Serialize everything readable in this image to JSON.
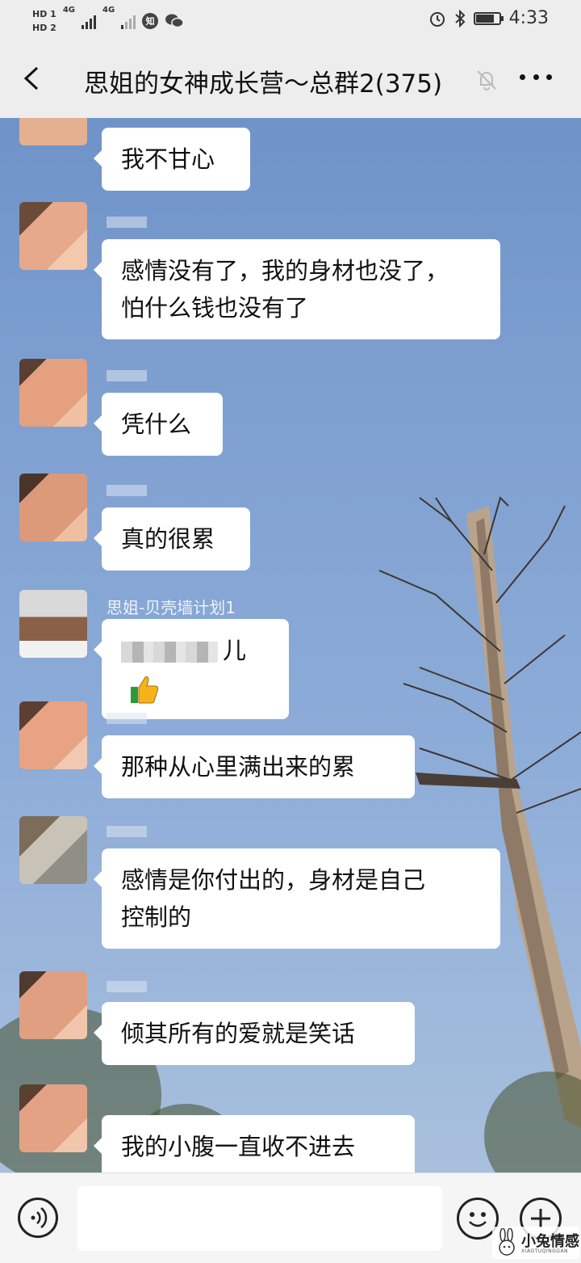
{
  "status_bar": {
    "hd1": "HD 1",
    "hd2": "HD 2",
    "net1": "4G",
    "net2": "4G",
    "app_badge": "知",
    "time": "4:33",
    "battery_level": 0.8,
    "icons": [
      "alarm-icon",
      "bluetooth-icon",
      "battery-icon",
      "wechat-icon"
    ]
  },
  "header": {
    "back_icon": "chevron-left-icon",
    "title": "思姐的女神成长营～总群2(375)",
    "mute_icon": "bell-muted-icon",
    "more_icon": "more-dots-icon"
  },
  "messages": [
    {
      "text": "我不甘心"
    },
    {
      "text_line1": "感情没有了，我的身材也没了，",
      "text_line2": "怕什么钱也没有了"
    },
    {
      "text": "凭什么"
    },
    {
      "text": "真的很累"
    },
    {
      "sender": "思姐-贝壳墙计划1",
      "text": "儿",
      "emoji": "thumbs-up-icon"
    },
    {
      "text": "那种从心里满出来的累"
    },
    {
      "text_line1": "感情是你付出的，身材是自己",
      "text_line2": "控制的"
    },
    {
      "text": "倾其所有的爱就是笑话"
    },
    {
      "text": "我的小腹一直收不进去"
    }
  ],
  "input_bar": {
    "voice_icon": "voice-icon",
    "input_value": "",
    "emoji_icon": "smiley-icon",
    "plus_icon": "plus-icon"
  },
  "watermark": {
    "text": "小兔情感",
    "subtext": "XIAOTUQINGGAN"
  },
  "colors": {
    "sky_top": "#6f93c8",
    "bubble": "#ffffff",
    "header_bg": "#ededed"
  }
}
